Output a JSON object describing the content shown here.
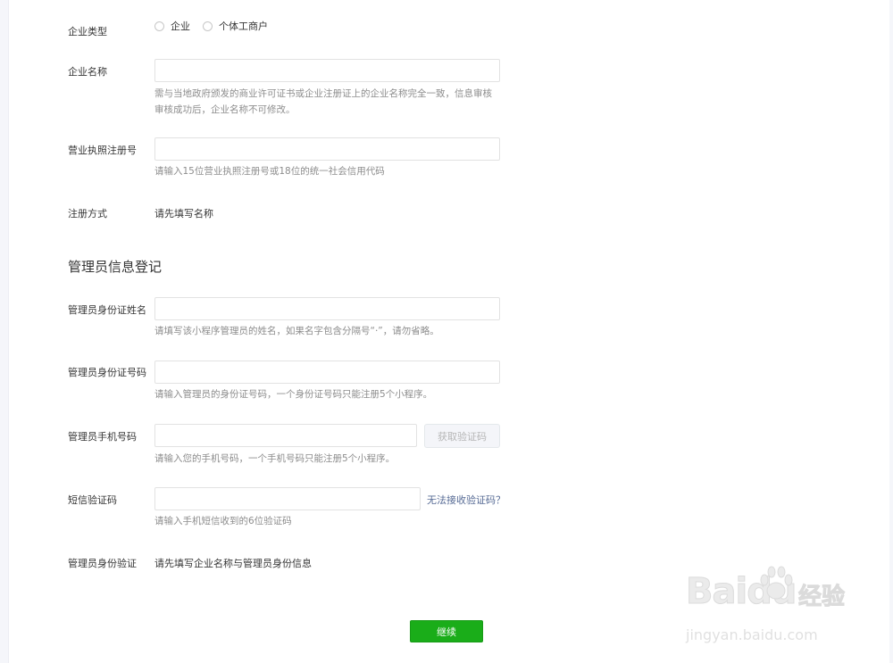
{
  "company_type": {
    "label": "企业类型",
    "options": [
      "企业",
      "个体工商户"
    ]
  },
  "company_name": {
    "label": "企业名称",
    "value": "",
    "tips": [
      "需与当地政府颁发的商业许可证书或企业注册证上的企业名称完全一致，信息审核",
      "审核成功后，企业名称不可修改。"
    ]
  },
  "license_number": {
    "label": "营业执照注册号",
    "value": "",
    "tips": "请输入15位营业执照注册号或18位的统一社会信用代码"
  },
  "register_method": {
    "label": "注册方式",
    "value": "请先填写名称"
  },
  "admin_section": {
    "title": "管理员信息登记"
  },
  "admin_name": {
    "label": "管理员身份证姓名",
    "value": "",
    "tips": "请填写该小程序管理员的姓名，如果名字包含分隔号“·”，请勿省略。"
  },
  "admin_id": {
    "label": "管理员身份证号码",
    "value": "",
    "tips": "请输入管理员的身份证号码，一个身份证号码只能注册5个小程序。"
  },
  "admin_phone": {
    "label": "管理员手机号码",
    "value": "",
    "get_code_button": "获取验证码",
    "tips": "请输入您的手机号码，一个手机号码只能注册5个小程序。"
  },
  "sms_code": {
    "label": "短信验证码",
    "value": "",
    "help_link": "无法接收验证码？",
    "tips": "请输入手机短信收到的6位验证码"
  },
  "admin_verify": {
    "label": "管理员身份验证",
    "value": "请先填写企业名称与管理员身份信息"
  },
  "continue_button": "继续",
  "watermark": {
    "brand": "Baidu",
    "brand_cn": "经验",
    "url": "jingyan.baidu.com"
  },
  "colors": {
    "primary": "#1aad19",
    "link": "#576b95",
    "tip": "#8d8d8d",
    "text": "#353535"
  }
}
